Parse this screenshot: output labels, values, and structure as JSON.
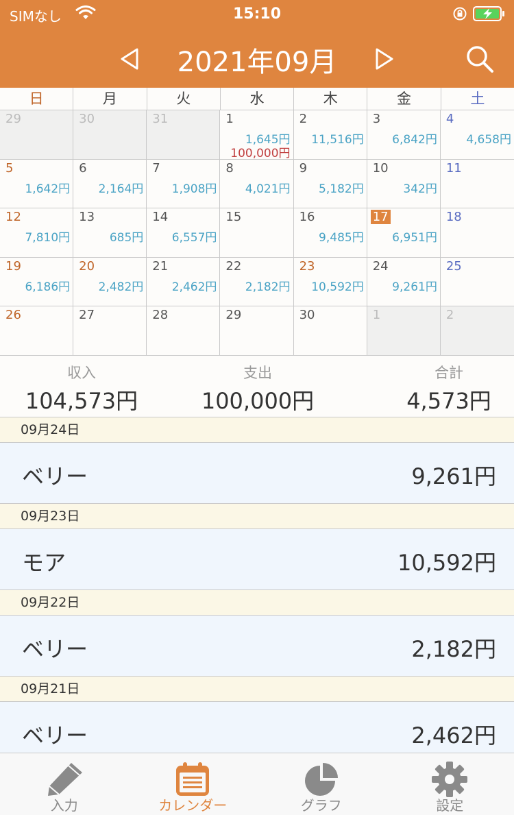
{
  "status": {
    "carrier": "SIMなし",
    "time": "15:10"
  },
  "header": {
    "title": "2021年09月"
  },
  "weekdays": [
    "日",
    "月",
    "火",
    "水",
    "木",
    "金",
    "土"
  ],
  "calendar": [
    {
      "day": "29",
      "out": true
    },
    {
      "day": "30",
      "out": true
    },
    {
      "day": "31",
      "out": true
    },
    {
      "day": "1",
      "expense": "1,645円",
      "income": "100,000円"
    },
    {
      "day": "2",
      "expense": "11,516円"
    },
    {
      "day": "3",
      "expense": "6,842円"
    },
    {
      "day": "4",
      "expense": "4,658円",
      "sat": true
    },
    {
      "day": "5",
      "expense": "1,642円",
      "sun": true
    },
    {
      "day": "6",
      "expense": "2,164円"
    },
    {
      "day": "7",
      "expense": "1,908円"
    },
    {
      "day": "8",
      "expense": "4,021円"
    },
    {
      "day": "9",
      "expense": "5,182円"
    },
    {
      "day": "10",
      "expense": "342円"
    },
    {
      "day": "11",
      "sat": true
    },
    {
      "day": "12",
      "expense": "7,810円",
      "sun": true
    },
    {
      "day": "13",
      "expense": "685円"
    },
    {
      "day": "14",
      "expense": "6,557円"
    },
    {
      "day": "15"
    },
    {
      "day": "16",
      "expense": "9,485円"
    },
    {
      "day": "17",
      "expense": "6,951円",
      "today": true
    },
    {
      "day": "18",
      "sat": true
    },
    {
      "day": "19",
      "expense": "6,186円",
      "sun": true
    },
    {
      "day": "20",
      "expense": "2,482円",
      "sun": true
    },
    {
      "day": "21",
      "expense": "2,462円"
    },
    {
      "day": "22",
      "expense": "2,182円"
    },
    {
      "day": "23",
      "expense": "10,592円",
      "sun": true
    },
    {
      "day": "24",
      "expense": "9,261円"
    },
    {
      "day": "25",
      "sat": true
    },
    {
      "day": "26",
      "sun": true
    },
    {
      "day": "27"
    },
    {
      "day": "28"
    },
    {
      "day": "29"
    },
    {
      "day": "30"
    },
    {
      "day": "1",
      "out": true
    },
    {
      "day": "2",
      "out": true
    }
  ],
  "summary": {
    "income_label": "収入",
    "income_value": "104,573円",
    "expense_label": "支出",
    "expense_value": "100,000円",
    "total_label": "合計",
    "total_value": "4,573円"
  },
  "entries": [
    {
      "date": "09月24日",
      "name": "ベリー",
      "amount": "9,261円"
    },
    {
      "date": "09月23日",
      "name": "モア",
      "amount": "10,592円"
    },
    {
      "date": "09月22日",
      "name": "ベリー",
      "amount": "2,182円"
    },
    {
      "date": "09月21日",
      "name": "ベリー",
      "amount": "2,462円"
    }
  ],
  "tabs": [
    {
      "label": "入力",
      "icon": "pencil-icon"
    },
    {
      "label": "カレンダー",
      "icon": "calendar-icon",
      "active": true
    },
    {
      "label": "グラフ",
      "icon": "pie-chart-icon"
    },
    {
      "label": "設定",
      "icon": "gear-icon"
    }
  ],
  "colors": {
    "accent": "#df853f",
    "expense": "#4aa3c5",
    "income": "#c14040",
    "saturday": "#5a6cc1",
    "sunday": "#c0662a"
  }
}
